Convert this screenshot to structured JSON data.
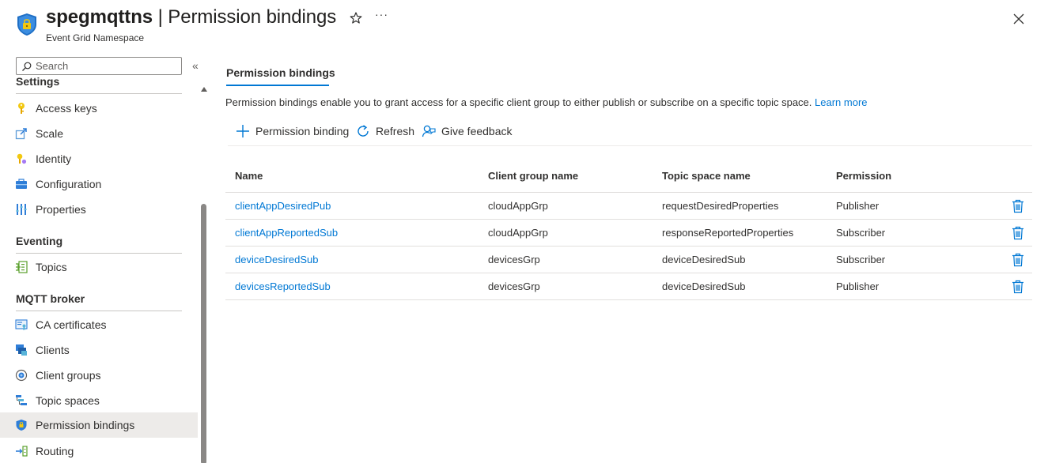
{
  "header": {
    "resource_name": "spegmqttns",
    "separator": " | ",
    "page_name": "Permission bindings",
    "resource_type": "Event Grid Namespace",
    "more_label": "···"
  },
  "sidebar": {
    "search_placeholder": "Search",
    "collapse_label": "«",
    "settings_section": "Settings",
    "settings_items": [
      {
        "label": "Access keys",
        "icon": "key-icon"
      },
      {
        "label": "Scale",
        "icon": "scale-icon"
      },
      {
        "label": "Identity",
        "icon": "identity-icon"
      },
      {
        "label": "Configuration",
        "icon": "configuration-icon"
      },
      {
        "label": "Properties",
        "icon": "properties-icon"
      }
    ],
    "eventing_section": "Eventing",
    "eventing_items": [
      {
        "label": "Topics",
        "icon": "topics-icon"
      }
    ],
    "mqtt_section": "MQTT broker",
    "mqtt_items": [
      {
        "label": "CA certificates",
        "icon": "certificate-icon"
      },
      {
        "label": "Clients",
        "icon": "clients-icon"
      },
      {
        "label": "Client groups",
        "icon": "client-groups-icon"
      },
      {
        "label": "Topic spaces",
        "icon": "topic-spaces-icon"
      },
      {
        "label": "Permission bindings",
        "icon": "shield-icon",
        "active": true
      },
      {
        "label": "Routing",
        "icon": "routing-icon"
      }
    ]
  },
  "main": {
    "tab_label": "Permission bindings",
    "description": "Permission bindings enable you to grant access for a specific client group to either publish or subscribe on a specific topic space.",
    "learn_more": "Learn more",
    "toolbar": {
      "add_label": "Permission binding",
      "refresh_label": "Refresh",
      "feedback_label": "Give feedback"
    },
    "table": {
      "columns": [
        "Name",
        "Client group name",
        "Topic space name",
        "Permission"
      ],
      "rows": [
        {
          "name": "clientAppDesiredPub",
          "client_group": "cloudAppGrp",
          "topic_space": "requestDesiredProperties",
          "permission": "Publisher"
        },
        {
          "name": "clientAppReportedSub",
          "client_group": "cloudAppGrp",
          "topic_space": "responseReportedProperties",
          "permission": "Subscriber"
        },
        {
          "name": "deviceDesiredSub",
          "client_group": "devicesGrp",
          "topic_space": "deviceDesiredSub",
          "permission": "Subscriber"
        },
        {
          "name": "devicesReportedSub",
          "client_group": "devicesGrp",
          "topic_space": "deviceDesiredSub",
          "permission": "Publisher"
        }
      ]
    }
  },
  "colors": {
    "accent": "#0078d4",
    "active_nav_bg": "#edebe9",
    "text": "#323130"
  }
}
